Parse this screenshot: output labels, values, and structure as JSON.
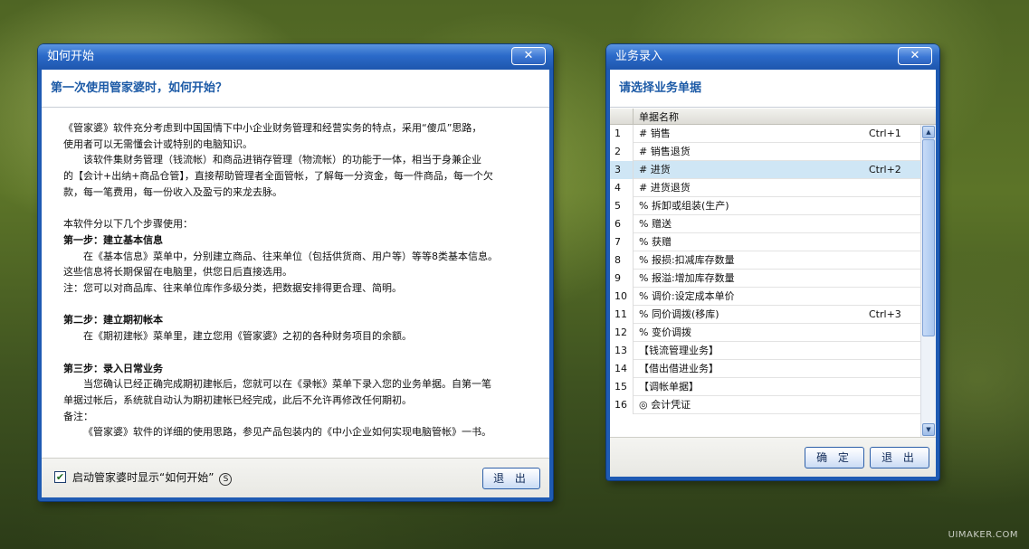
{
  "left_window": {
    "title": "如何开始",
    "close_label": "✕",
    "heading": "第一次使用管家婆时，如何开始？",
    "lines": [
      {
        "text": "《管家婆》软件充分考虑到中国国情下中小企业财务管理和经营实务的特点，采用“傻瓜”思路，",
        "style": ""
      },
      {
        "text": "使用者可以无需懂会计或特别的电脑知识。",
        "style": ""
      },
      {
        "text": "该软件集财务管理（钱流帐）和商品进销存管理（物流帐）的功能于一体，相当于身兼企业",
        "style": "ind"
      },
      {
        "text": "的【会计+出纳+商品仓管】，直接帮助管理者全面管帐，了解每一分资金，每一件商品，每一个欠",
        "style": ""
      },
      {
        "text": "款，每一笔费用，每一份收入及盈亏的来龙去脉。",
        "style": ""
      },
      {
        "text": "",
        "style": "gap"
      },
      {
        "text": "本软件分以下几个步骤使用：",
        "style": ""
      },
      {
        "text": "第一步：建立基本信息",
        "style": "bold"
      },
      {
        "text": "在《基本信息》菜单中，分别建立商品、往来单位（包括供货商、用户等）等等8类基本信息。",
        "style": "ind"
      },
      {
        "text": "这些信息将长期保留在电脑里，供您日后直接选用。",
        "style": ""
      },
      {
        "text": "注：您可以对商品库、往来单位库作多级分类，把数据安排得更合理、简明。",
        "style": ""
      },
      {
        "text": "",
        "style": "gap"
      },
      {
        "text": "第二步：建立期初帐本",
        "style": "bold"
      },
      {
        "text": "在《期初建帐》菜单里，建立您用《管家婆》之初的各种财务项目的余额。",
        "style": "ind"
      },
      {
        "text": "",
        "style": "gap"
      },
      {
        "text": "第三步：录入日常业务",
        "style": "bold"
      },
      {
        "text": "当您确认已经正确完成期初建帐后，您就可以在《录帐》菜单下录入您的业务单据。自第一笔",
        "style": "ind"
      },
      {
        "text": "单据过帐后，系统就自动认为期初建帐已经完成，此后不允许再修改任何期初。",
        "style": ""
      },
      {
        "text": "备注：",
        "style": ""
      },
      {
        "text": "《管家婆》软件的详细的使用思路，参见产品包装内的《中小企业如何实现电脑管帐》一书。",
        "style": "ind"
      }
    ],
    "checkbox_checked": true,
    "checkbox_mark": "✔",
    "checkbox_label": "启动管家婆时显示“如何开始”",
    "shortcut_letter": "S",
    "exit_label": "退 出"
  },
  "right_window": {
    "title": "业务录入",
    "close_label": "✕",
    "heading": "请选择业务单据",
    "column_header": "单据名称",
    "rows": [
      {
        "num": "1",
        "name": "# 销售",
        "shortcut": "Ctrl+1",
        "selected": false
      },
      {
        "num": "2",
        "name": "# 销售退货",
        "shortcut": "",
        "selected": false
      },
      {
        "num": "3",
        "name": "# 进货",
        "shortcut": "Ctrl+2",
        "selected": true
      },
      {
        "num": "4",
        "name": "# 进货退货",
        "shortcut": "",
        "selected": false
      },
      {
        "num": "5",
        "name": "% 拆卸或组装(生产)",
        "shortcut": "",
        "selected": false
      },
      {
        "num": "6",
        "name": "% 赠送",
        "shortcut": "",
        "selected": false
      },
      {
        "num": "7",
        "name": "% 获赠",
        "shortcut": "",
        "selected": false
      },
      {
        "num": "8",
        "name": "% 报损:扣减库存数量",
        "shortcut": "",
        "selected": false
      },
      {
        "num": "9",
        "name": "% 报溢:增加库存数量",
        "shortcut": "",
        "selected": false
      },
      {
        "num": "10",
        "name": "% 调价:设定成本单价",
        "shortcut": "",
        "selected": false
      },
      {
        "num": "11",
        "name": "% 同价调拨(移库)",
        "shortcut": "Ctrl+3",
        "selected": false
      },
      {
        "num": "12",
        "name": "% 变价调拨",
        "shortcut": "",
        "selected": false
      },
      {
        "num": "13",
        "name": "【钱流管理业务】",
        "shortcut": "",
        "selected": false
      },
      {
        "num": "14",
        "name": "【借出借进业务】",
        "shortcut": "",
        "selected": false
      },
      {
        "num": "15",
        "name": "【调帐单据】",
        "shortcut": "",
        "selected": false
      },
      {
        "num": "16",
        "name": "◎ 会计凭证",
        "shortcut": "",
        "selected": false
      }
    ],
    "scroll_up": "▲",
    "scroll_down": "▼",
    "ok_label": "确 定",
    "exit_label": "退 出"
  },
  "watermark": "UIMAKER.COM"
}
